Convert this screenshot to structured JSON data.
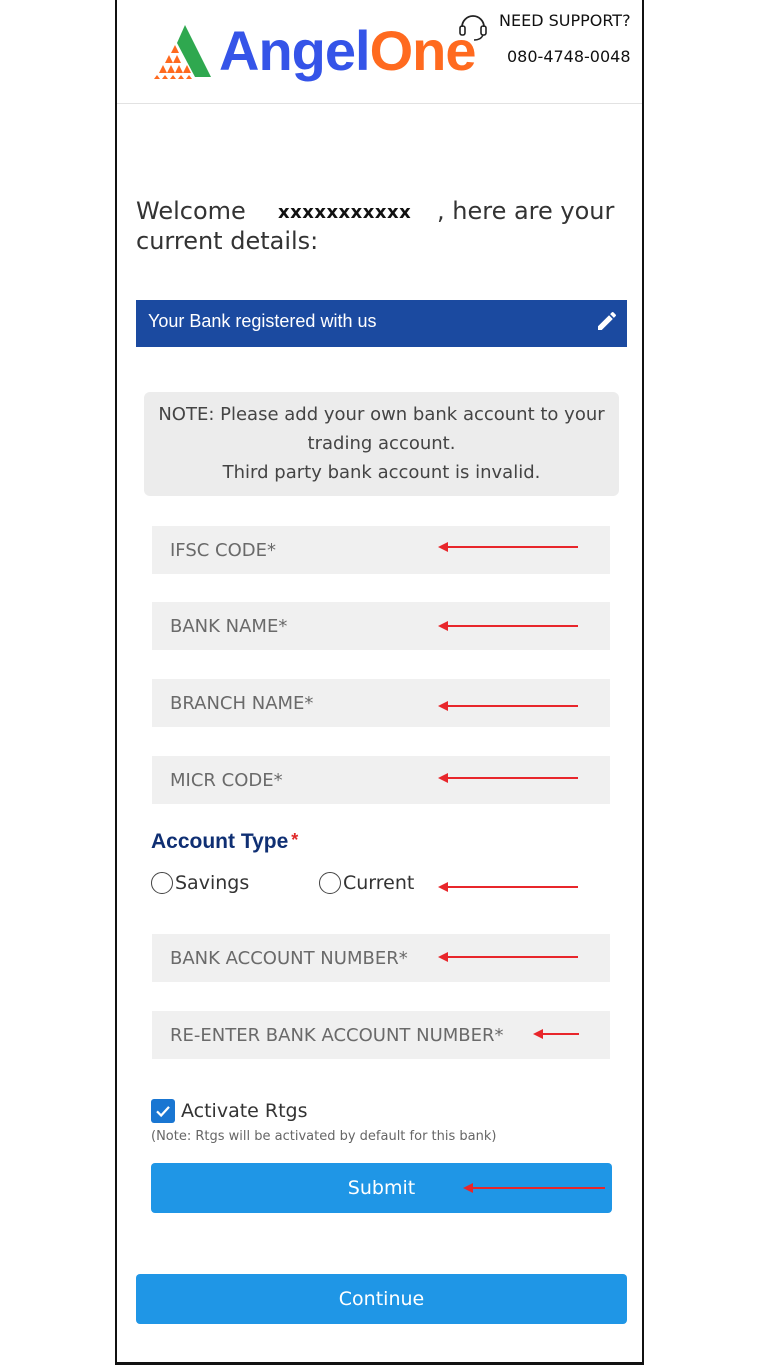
{
  "header": {
    "logo_part1": "Angel",
    "logo_part2": "One",
    "support_title": "NEED SUPPORT?",
    "support_phone": "080-4748-0048",
    "logo_icon": "triangle-mosaic-logo",
    "support_icon": "headset-icon"
  },
  "welcome": {
    "prefix": "Welcome",
    "masked_name": "xxxxxxxxxxx",
    "suffix": ", here are your",
    "line2": "current details:"
  },
  "bank_section": {
    "title": "Your Bank registered with us",
    "edit_icon": "pencil-icon",
    "bar_color": "#1b4aa0"
  },
  "note": {
    "line1": "NOTE: Please add your own bank account to your",
    "line2": "trading account.",
    "line3": "Third party bank account is invalid."
  },
  "fields": {
    "ifsc_placeholder": "IFSC CODE*",
    "bank_name_placeholder": "BANK NAME*",
    "branch_name_placeholder": "BRANCH NAME*",
    "micr_placeholder": "MICR CODE*",
    "account_number_placeholder": "BANK ACCOUNT NUMBER*",
    "reenter_account_placeholder": "RE-ENTER BANK ACCOUNT NUMBER*"
  },
  "account_type": {
    "label": "Account Type",
    "required_mark": "*",
    "options": [
      "Savings",
      "Current"
    ]
  },
  "rtgs": {
    "label": "Activate Rtgs",
    "checked": true,
    "note": "(Note: Rtgs will be activated by default for this bank)"
  },
  "buttons": {
    "submit": "Submit",
    "continue": "Continue",
    "button_color": "#1f96e6"
  },
  "annotation_color": "#e8262b"
}
